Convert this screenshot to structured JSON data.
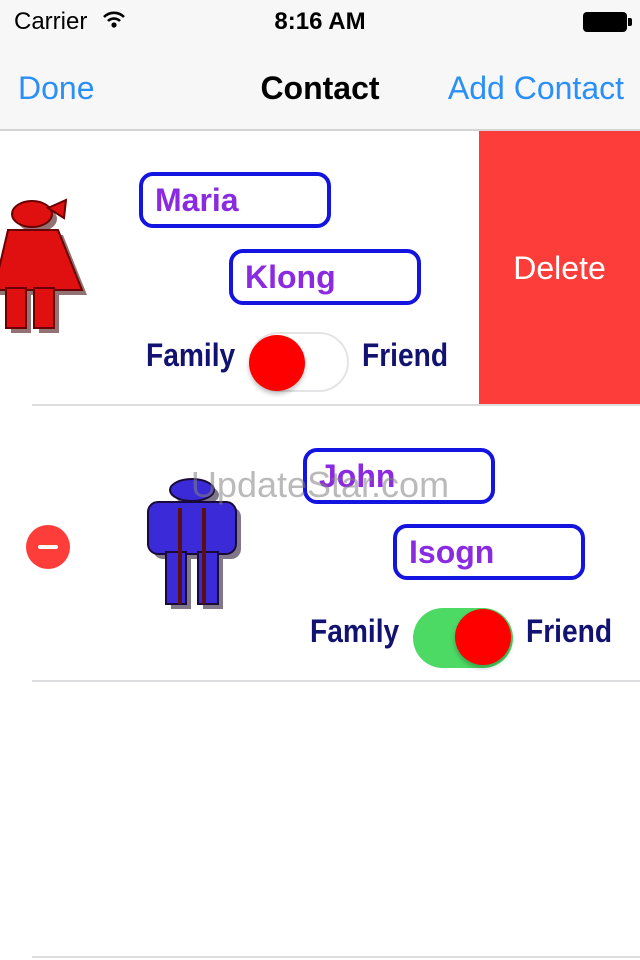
{
  "status_bar": {
    "carrier": "Carrier",
    "time": "8:16 AM"
  },
  "nav": {
    "left_label": "Done",
    "title": "Contact",
    "right_label": "Add Contact"
  },
  "contacts": [
    {
      "first_name": "Maria",
      "last_name": "Klong",
      "family_label": "Family",
      "friend_label": "Friend",
      "friend_toggle_on": false,
      "avatar_icon": "female-person-icon",
      "avatar_color": "#e01010"
    },
    {
      "first_name": "John",
      "last_name": "Isogn",
      "family_label": "Family",
      "friend_label": "Friend",
      "friend_toggle_on": true,
      "avatar_icon": "male-person-icon",
      "avatar_color": "#3a2ad8"
    }
  ],
  "row_actions": {
    "delete_label": "Delete"
  },
  "watermark": "UpdateStar.com",
  "colors": {
    "accent": "#2a8ff7",
    "delete": "#fc3d39",
    "toggle_on": "#4cd964",
    "knob": "#ff0000",
    "field_border": "#1414e0",
    "name_text": "#8a2be2",
    "label_text": "#121270"
  }
}
